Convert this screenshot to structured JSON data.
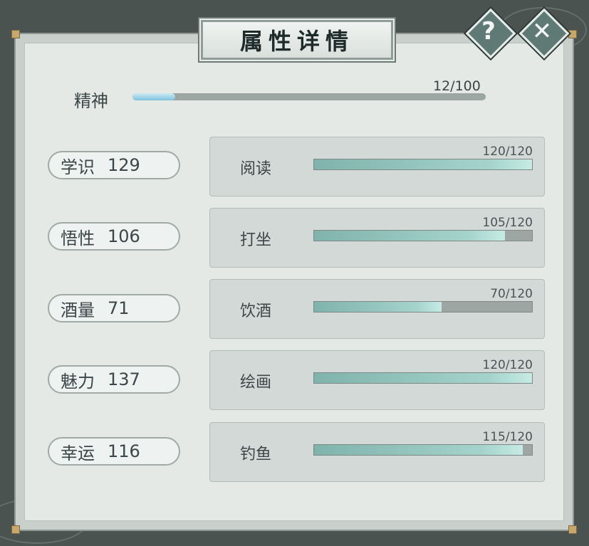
{
  "title": "属性详情",
  "buttons": {
    "help_icon": "?",
    "close_icon": "✕"
  },
  "spirit": {
    "label": "精神",
    "value_text": "12/100",
    "current": 12,
    "max": 100
  },
  "attributes": [
    {
      "name": "学识",
      "value": "129"
    },
    {
      "name": "悟性",
      "value": "106"
    },
    {
      "name": "酒量",
      "value": "71"
    },
    {
      "name": "魅力",
      "value": "137"
    },
    {
      "name": "幸运",
      "value": "116"
    }
  ],
  "skills": [
    {
      "name": "阅读",
      "value_text": "120/120",
      "current": 120,
      "max": 120
    },
    {
      "name": "打坐",
      "value_text": "105/120",
      "current": 105,
      "max": 120
    },
    {
      "name": "饮酒",
      "value_text": "70/120",
      "current": 70,
      "max": 120
    },
    {
      "name": "绘画",
      "value_text": "120/120",
      "current": 120,
      "max": 120
    },
    {
      "name": "钓鱼",
      "value_text": "115/120",
      "current": 115,
      "max": 120
    }
  ],
  "colors": {
    "bar_fill": "#a4d3cb",
    "spirit_fill": "#7cc3de",
    "panel": "#e4e9e6"
  }
}
